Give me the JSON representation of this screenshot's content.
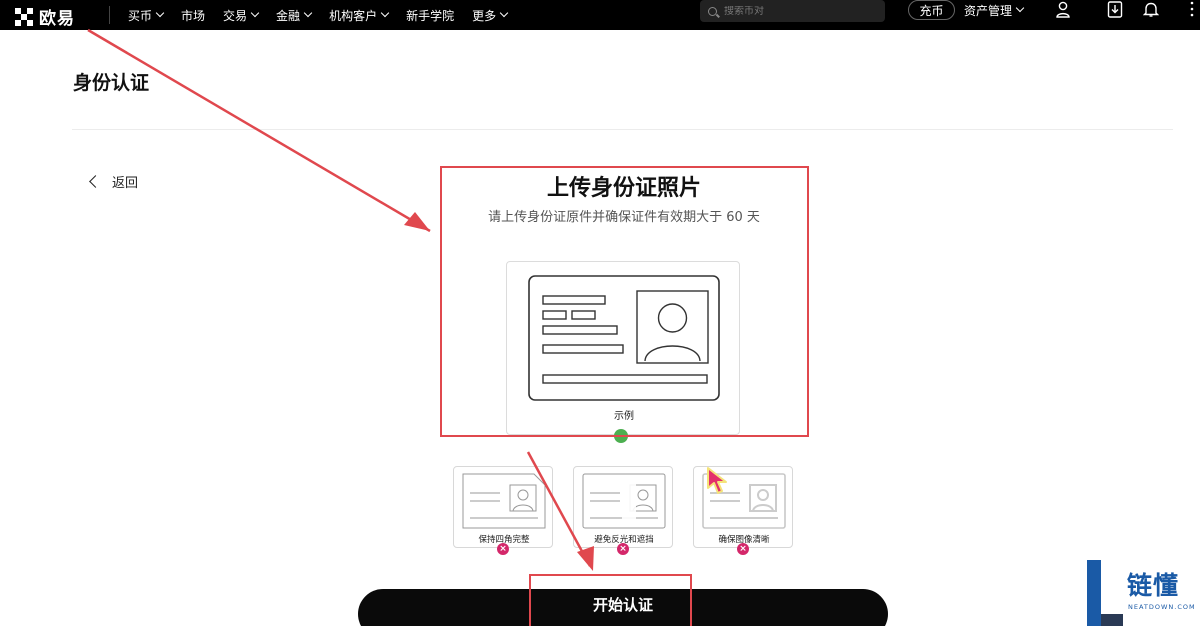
{
  "nav": {
    "logo_text": "欧易",
    "items": [
      {
        "label": "买币",
        "has_caret": true
      },
      {
        "label": "市场",
        "has_caret": false
      },
      {
        "label": "交易",
        "has_caret": true
      },
      {
        "label": "金融",
        "has_caret": true
      },
      {
        "label": "机构客户",
        "has_caret": true
      },
      {
        "label": "新手学院",
        "has_caret": false
      },
      {
        "label": "更多",
        "has_caret": true
      }
    ],
    "search_placeholder": "搜索币对",
    "deposit_label": "充币",
    "asset_label": "资产管理"
  },
  "page": {
    "title": "身份认证",
    "back_label": "返回"
  },
  "upload": {
    "title": "上传身份证照片",
    "subtitle": "请上传身份证原件并确保证件有效期大于 60 天",
    "example_label": "示例"
  },
  "tips": [
    {
      "label": "保持四角完整",
      "icon": "x-icon"
    },
    {
      "label": "避免反光和遮挡",
      "icon": "x-icon"
    },
    {
      "label": "确保图像清晰",
      "icon": "x-icon"
    }
  ],
  "actions": {
    "start_label": "开始认证"
  },
  "watermark": {
    "text": "链懂",
    "sub": "NEATDOWN.COM"
  },
  "colors": {
    "annotation": "#e0484e",
    "error_badge": "#d4276a",
    "highlight_dot": "#4caf50",
    "watermark": "#1a5aa6"
  }
}
